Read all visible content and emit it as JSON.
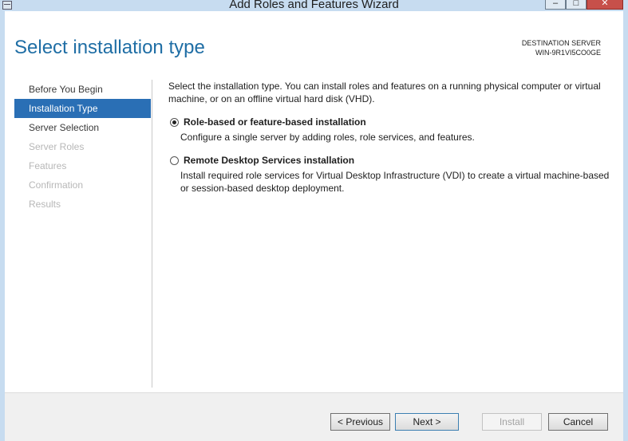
{
  "window": {
    "title": "Add Roles and Features Wizard",
    "min_glyph": "‒",
    "max_glyph": "□",
    "close_glyph": "✕"
  },
  "header": {
    "page_title": "Select installation type",
    "destination_label": "DESTINATION SERVER",
    "destination_value": "WIN-9R1VI5CO0GE"
  },
  "steps": [
    {
      "label": "Before You Begin",
      "state": "normal"
    },
    {
      "label": "Installation Type",
      "state": "active"
    },
    {
      "label": "Server Selection",
      "state": "normal"
    },
    {
      "label": "Server Roles",
      "state": "disabled"
    },
    {
      "label": "Features",
      "state": "disabled"
    },
    {
      "label": "Confirmation",
      "state": "disabled"
    },
    {
      "label": "Results",
      "state": "disabled"
    }
  ],
  "content": {
    "intro": "Select the installation type. You can install roles and features on a running physical computer or virtual machine, or on an offline virtual hard disk (VHD).",
    "options": [
      {
        "label": "Role-based or feature-based installation",
        "description": "Configure a single server by adding roles, role services, and features.",
        "selected": true
      },
      {
        "label": "Remote Desktop Services installation",
        "description": "Install required role services for Virtual Desktop Infrastructure (VDI) to create a virtual machine-based or session-based desktop deployment.",
        "selected": false
      }
    ]
  },
  "buttons": {
    "previous": "< Previous",
    "next": "Next >",
    "install": "Install",
    "cancel": "Cancel"
  },
  "colors": {
    "accent": "#2a6fb5",
    "title": "#1f6ea5",
    "frame": "#c7dcf0",
    "close": "#c7504a"
  }
}
